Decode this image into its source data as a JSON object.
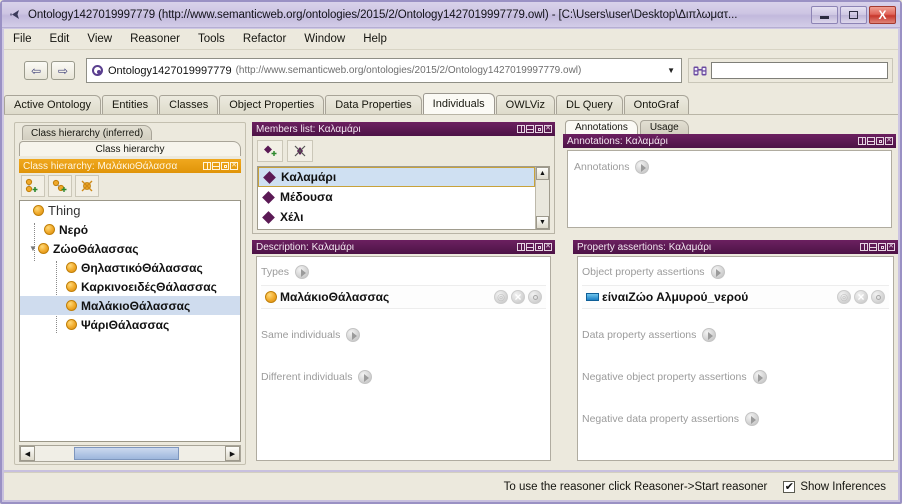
{
  "window": {
    "title": "Ontology1427019997779 (http://www.semanticweb.org/ontologies/2015/2/Ontology1427019997779.owl) - [C:\\Users\\user\\Desktop\\Διπλωματ...",
    "app_icon": "protege-icon",
    "minimize_label": "Minimize",
    "maximize_label": "Maximize",
    "close_label": "X"
  },
  "menubar": {
    "items": [
      {
        "label": "File"
      },
      {
        "label": "Edit"
      },
      {
        "label": "View"
      },
      {
        "label": "Reasoner"
      },
      {
        "label": "Tools"
      },
      {
        "label": "Refactor"
      },
      {
        "label": "Window"
      },
      {
        "label": "Help"
      }
    ]
  },
  "toolbar": {
    "back_glyph": "⇦",
    "forward_glyph": "⇨",
    "ontology_name": "Ontology1427019997779",
    "ontology_iri": "(http://www.semanticweb.org/ontologies/2015/2/Ontology1427019997779.owl)",
    "dropdown_glyph": "▼",
    "search_value": "",
    "search_placeholder": ""
  },
  "tabs": [
    {
      "label": "Active Ontology",
      "selected": false
    },
    {
      "label": "Entities",
      "selected": false
    },
    {
      "label": "Classes",
      "selected": false
    },
    {
      "label": "Object Properties",
      "selected": false
    },
    {
      "label": "Data Properties",
      "selected": false
    },
    {
      "label": "Individuals",
      "selected": true
    },
    {
      "label": "OWLViz",
      "selected": false
    },
    {
      "label": "DL Query",
      "selected": false
    },
    {
      "label": "OntoGraf",
      "selected": false
    }
  ],
  "class_hierarchy": {
    "tab_inferred": "Class hierarchy (inferred)",
    "tab_asserted": "Class hierarchy",
    "view_title": "Class hierarchy: ΜαλάκιοΘάλασσα",
    "toolbar": [
      {
        "name": "add-subclass-button"
      },
      {
        "name": "add-sibling-class-button"
      },
      {
        "name": "delete-class-button"
      }
    ],
    "tree": [
      {
        "label": "Thing",
        "depth": 0,
        "twisty": "",
        "selected": false,
        "bold": false
      },
      {
        "label": "Νερό",
        "depth": 1,
        "twisty": "",
        "selected": false,
        "bold": true
      },
      {
        "label": "ΖώοΘάλασσας",
        "depth": 1,
        "twisty": "▼",
        "selected": false,
        "bold": true
      },
      {
        "label": "ΘηλαστικόΘάλασσας",
        "depth": 2,
        "twisty": "",
        "selected": false,
        "bold": true
      },
      {
        "label": "ΚαρκινοειδέςΘάλασσας",
        "depth": 2,
        "twisty": "",
        "selected": false,
        "bold": true
      },
      {
        "label": "ΜαλάκιοΘάλασσας",
        "depth": 2,
        "twisty": "",
        "selected": true,
        "bold": true
      },
      {
        "label": "ΨάριΘάλασσας",
        "depth": 2,
        "twisty": "",
        "selected": false,
        "bold": true
      }
    ],
    "scroll_left_glyph": "◀",
    "scroll_right_glyph": "▶"
  },
  "members_list": {
    "view_title": "Members list: Καλαμάρι",
    "toolbar": [
      {
        "name": "add-individual-button"
      },
      {
        "name": "delete-individual-button"
      }
    ],
    "items": [
      {
        "label": "Καλαμάρι",
        "selected": true
      },
      {
        "label": "Μέδουσα",
        "selected": false
      },
      {
        "label": "Χέλι",
        "selected": false
      }
    ],
    "scroll_up_glyph": "▲",
    "scroll_down_glyph": "▼"
  },
  "annotations": {
    "tabs": [
      {
        "label": "Annotations",
        "selected": true
      },
      {
        "label": "Usage",
        "selected": false
      }
    ],
    "view_title": "Annotations: Καλαμάρι",
    "section_label": "Annotations"
  },
  "description": {
    "view_title": "Description: Καλαμάρι",
    "sections": [
      {
        "label": "Types",
        "entry": {
          "text": "ΜαλάκιoΘάλασσας",
          "icon": "class-dot-icon",
          "has_buttons": true
        }
      },
      {
        "label": "Same individuals",
        "entry": null
      },
      {
        "label": "Different individuals",
        "entry": null
      }
    ]
  },
  "property_assertions": {
    "view_title": "Property assertions: Καλαμάρι",
    "sections": [
      {
        "label": "Object property assertions",
        "entry": {
          "text": "είναιΖώο  Αλμυρού_νερού",
          "icon": "object-property-icon",
          "has_buttons": true
        }
      },
      {
        "label": "Data property assertions",
        "entry": null
      },
      {
        "label": "Negative object property assertions",
        "entry": null
      },
      {
        "label": "Negative data property assertions",
        "entry": null
      }
    ]
  },
  "statusbar": {
    "message": "To use the reasoner click Reasoner->Start reasoner",
    "checkbox_label": "Show Inferences",
    "checkbox_checked": true
  },
  "colors": {
    "window_frame": "#9a91c4",
    "view_header_purple": "#5c1a53",
    "view_header_gold": "#eda014",
    "selection_blue": "#cfdcee",
    "class_icon": "#f0a92a",
    "individual_icon": "#5b1a55",
    "object_property_icon": "#1b7fc4"
  }
}
